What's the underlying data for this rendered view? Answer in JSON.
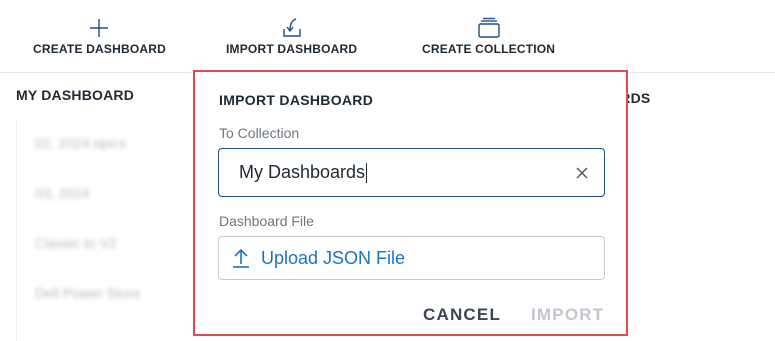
{
  "toolbar": {
    "create_dashboard": "CREATE DASHBOARD",
    "import_dashboard": "IMPORT DASHBOARD",
    "create_collection": "CREATE COLLECTION"
  },
  "left_panel": {
    "title": "MY DASHBOARD",
    "items": [
      "02, 2024 opics",
      "03, 2024",
      "Classic to V2",
      "Dell Power Store"
    ]
  },
  "right_panel": {
    "title_fragment": "ARDS"
  },
  "modal": {
    "title": "IMPORT DASHBOARD",
    "collection_label": "To Collection",
    "collection_value": "My Dashboards",
    "file_label": "Dashboard File",
    "upload_label": "Upload JSON File",
    "cancel_label": "CANCEL",
    "import_label": "IMPORT"
  },
  "colors": {
    "accent": "#1a73c4",
    "highlight_border": "#e14b4b",
    "input_border_focused": "#1d4f7a",
    "disabled_text": "#c2c7cd"
  },
  "icons": {
    "create": "plus-icon",
    "import": "import-icon",
    "collection": "collection-icon",
    "clear": "close-icon",
    "upload": "upload-arrow-icon"
  }
}
